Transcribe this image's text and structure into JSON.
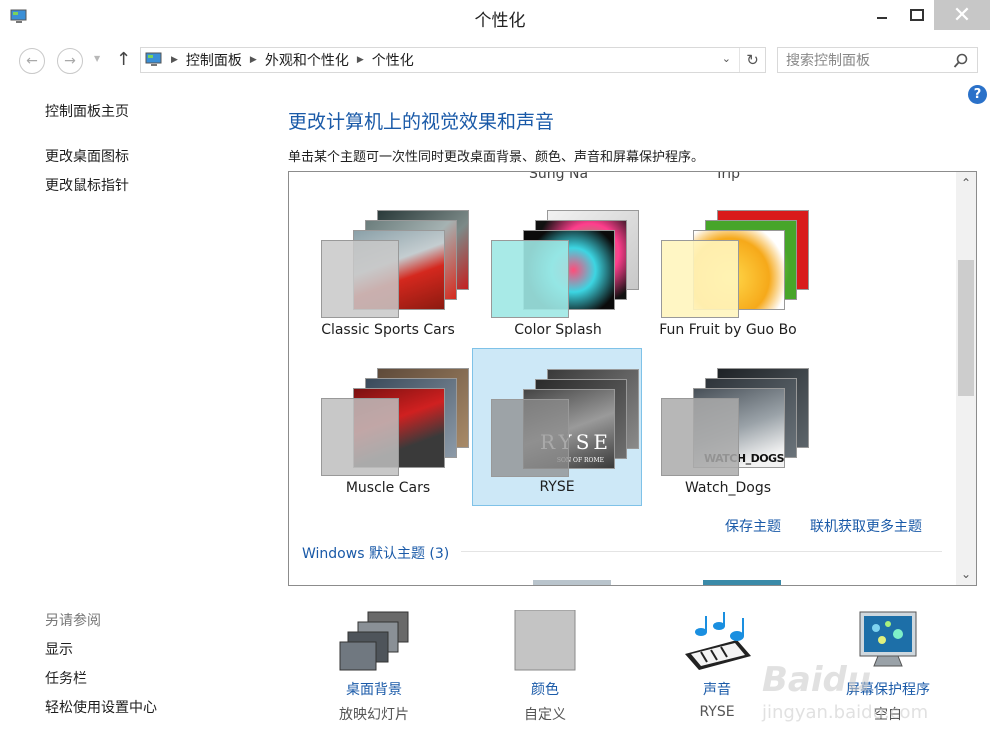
{
  "window": {
    "title": "个性化",
    "close_glyph": "✕"
  },
  "address": {
    "crumbs": [
      "控制面板",
      "外观和个性化",
      "个性化"
    ],
    "search_placeholder": "搜索控制面板"
  },
  "left_nav": {
    "home": "控制面板主页",
    "links": [
      "更改桌面图标",
      "更改鼠标指针"
    ],
    "see_also_title": "另请参阅",
    "see_also": [
      "显示",
      "任务栏",
      "轻松使用设置中心"
    ]
  },
  "main": {
    "heading": "更改计算机上的视觉效果和声音",
    "subheading": "单击某个主题可一次性同时更改桌面背景、颜色、声音和屏幕保护程序。",
    "partial_row": [
      "Sung Na",
      "Trip"
    ],
    "themes": [
      {
        "name": "Classic Sports Cars",
        "selected": false
      },
      {
        "name": "Color Splash",
        "selected": false
      },
      {
        "name": "Fun Fruit by Guo Bo",
        "selected": false
      },
      {
        "name": "Muscle Cars",
        "selected": false
      },
      {
        "name": "RYSE",
        "selected": true
      },
      {
        "name": "Watch_Dogs",
        "selected": false
      }
    ],
    "ryse_logo": "RYSE",
    "ryse_logo_sub": "SON OF ROME",
    "watchdogs_logo": "WATCH_DOGS",
    "save_theme": "保存主题",
    "more_themes": "联机获取更多主题",
    "group_title": "Windows 默认主题 (3)"
  },
  "bottom": [
    {
      "label": "桌面背景",
      "value": "放映幻灯片",
      "icon": "desktop-background-icon"
    },
    {
      "label": "颜色",
      "value": "自定义",
      "icon": "color-icon"
    },
    {
      "label": "声音",
      "value": "RYSE",
      "icon": "sounds-icon"
    },
    {
      "label": "屏幕保护程序",
      "value": "空白",
      "icon": "screen-saver-icon"
    }
  ],
  "watermark": {
    "logo": "Baidu",
    "url": "jingyan.baidu.com"
  }
}
